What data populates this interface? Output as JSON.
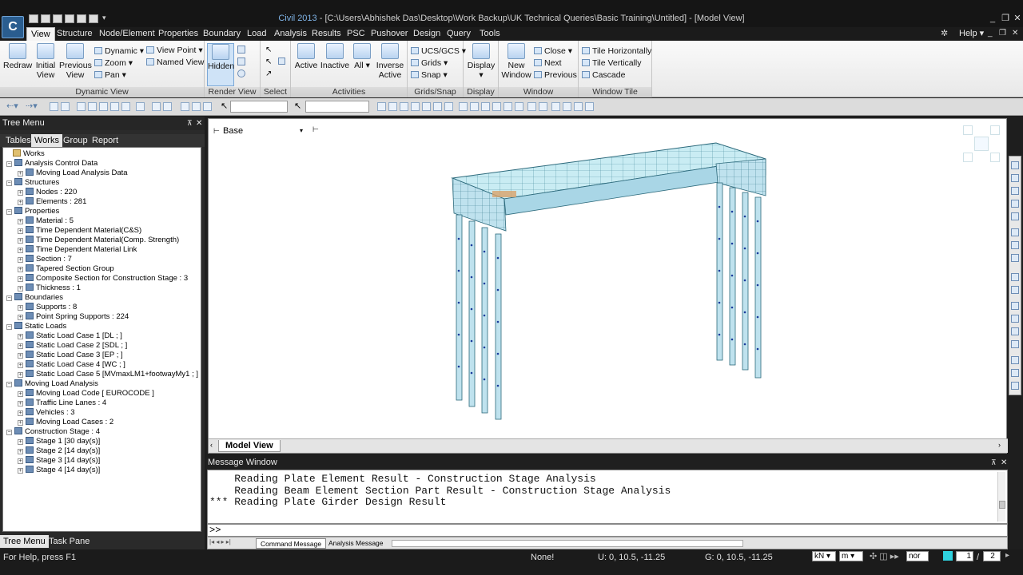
{
  "app": {
    "logo": "C",
    "title_app": "Civil 2013",
    "title_path": " - [C:\\Users\\Abhishek Das\\Desktop\\Work Backup\\UK Technical Queries\\Basic Training\\Untitled] - [Model View]"
  },
  "menu_tabs": [
    "View",
    "Structure",
    "Node/Element",
    "Properties",
    "Boundary",
    "Load",
    "Analysis",
    "Results",
    "PSC",
    "Pushover",
    "Design",
    "Query",
    "Tools"
  ],
  "help_label": "Help",
  "ribbon": {
    "groups": [
      "Dynamic View",
      "Render View",
      "Select",
      "Activities",
      "Grids/Snap",
      "Display",
      "Window",
      "Window Tile"
    ],
    "redraw": "Redraw",
    "initial_view_1": "Initial",
    "initial_view_2": "View",
    "previous_view_1": "Previous",
    "previous_view_2": "View",
    "dynamic": "Dynamic",
    "zoom": "Zoom",
    "pan": "Pan",
    "view_point": "View Point",
    "named_view": "Named View",
    "hidden": "Hidden",
    "active": "Active",
    "inactive": "Inactive",
    "all": "All",
    "inverse_active_1": "Inverse",
    "inverse_active_2": "Active",
    "ucs_gcs": "UCS/GCS",
    "grids": "Grids",
    "snap": "Snap",
    "display": "Display",
    "new_window_1": "New",
    "new_window_2": "Window",
    "close": "Close",
    "next": "Next",
    "previous": "Previous",
    "tile_h": "Tile Horizontally",
    "tile_v": "Tile Vertically",
    "cascade": "Cascade"
  },
  "tree": {
    "header": "Tree Menu",
    "tabs": [
      "Tables",
      "Works",
      "Group",
      "Report"
    ],
    "nodes": [
      {
        "label": "Works",
        "level": 0
      },
      {
        "label": "Analysis Control Data",
        "level": 1
      },
      {
        "label": "Moving Load Analysis Data",
        "level": 2
      },
      {
        "label": "Structures",
        "level": 1
      },
      {
        "label": "Nodes : 220",
        "level": 2
      },
      {
        "label": "Elements : 281",
        "level": 2
      },
      {
        "label": "Properties",
        "level": 1
      },
      {
        "label": "Material : 5",
        "level": 2
      },
      {
        "label": "Time Dependent Material(C&S)",
        "level": 2
      },
      {
        "label": "Time Dependent Material(Comp. Strength)",
        "level": 2
      },
      {
        "label": "Time Dependent Material Link",
        "level": 2
      },
      {
        "label": "Section : 7",
        "level": 2
      },
      {
        "label": "Tapered Section Group",
        "level": 2
      },
      {
        "label": "Composite Section for Construction Stage : 3",
        "level": 2
      },
      {
        "label": "Thickness : 1",
        "level": 2
      },
      {
        "label": "Boundaries",
        "level": 1
      },
      {
        "label": "Supports : 8",
        "level": 2
      },
      {
        "label": "Point Spring Supports : 224",
        "level": 2
      },
      {
        "label": "Static Loads",
        "level": 1
      },
      {
        "label": "Static Load Case 1 [DL ; ]",
        "level": 2
      },
      {
        "label": "Static Load Case 2 [SDL ; ]",
        "level": 2
      },
      {
        "label": "Static Load Case 3 [EP ; ]",
        "level": 2
      },
      {
        "label": "Static Load Case 4 [WC ; ]",
        "level": 2
      },
      {
        "label": "Static Load Case 5 [MVmaxLM1+footwayMy1 ; ]",
        "level": 2
      },
      {
        "label": "Moving Load Analysis",
        "level": 1
      },
      {
        "label": "Moving Load Code [ EUROCODE ]",
        "level": 2
      },
      {
        "label": "Traffic Line Lanes : 4",
        "level": 2
      },
      {
        "label": "Vehicles : 3",
        "level": 2
      },
      {
        "label": "Moving Load Cases : 2",
        "level": 2
      },
      {
        "label": "Construction Stage : 4",
        "level": 1
      },
      {
        "label": "Stage 1 [30 day(s)]",
        "level": 2
      },
      {
        "label": "Stage 2 [14 day(s)]",
        "level": 2
      },
      {
        "label": "Stage 3 [14 day(s)]",
        "level": 2
      },
      {
        "label": "Stage 4 [14 day(s)]",
        "level": 2
      }
    ],
    "bottom_tabs": [
      "Tree Menu",
      "Task Pane"
    ]
  },
  "model_view": {
    "combo_value": "Base",
    "tab_label": "Model View"
  },
  "message_window": {
    "header": "Message Window",
    "lines": [
      "    Reading Plate Element Result - Construction Stage Analysis",
      "    Reading Beam Element Section Part Result - Construction Stage Analysis",
      "*** Reading Plate Girder Design Result"
    ],
    "prompt": ">>",
    "tabs": [
      "Command Message",
      "Analysis Message"
    ]
  },
  "status": {
    "help": "For Help, press F1",
    "none": "None!",
    "ucs": "U: 0, 10.5, -11.25",
    "gcs": "G: 0, 10.5, -11.25",
    "force_unit": "kN",
    "length_unit": "m",
    "extra_combo": "nor",
    "page": "1",
    "page_total": "2"
  }
}
